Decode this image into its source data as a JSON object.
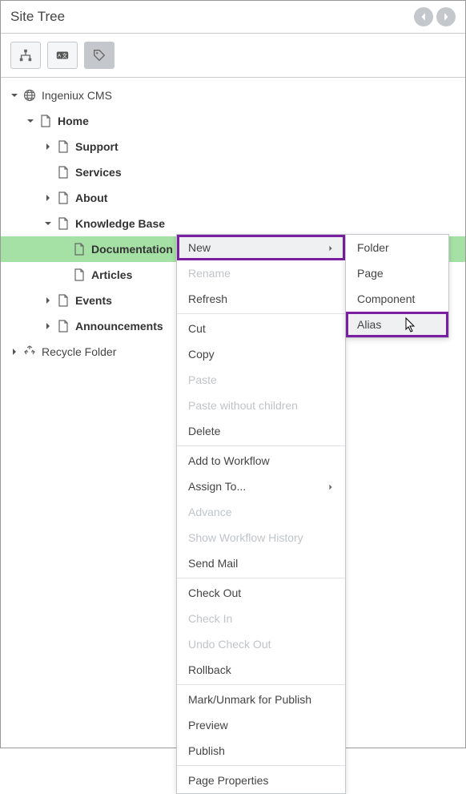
{
  "header": {
    "title": "Site Tree"
  },
  "tree": {
    "root": {
      "label": "Ingeniux CMS"
    },
    "home": {
      "label": "Home"
    },
    "support": {
      "label": "Support"
    },
    "services": {
      "label": "Services"
    },
    "about": {
      "label": "About"
    },
    "kb": {
      "label": "Knowledge Base"
    },
    "doc": {
      "label": "Documentation"
    },
    "articles": {
      "label": "Articles"
    },
    "events": {
      "label": "Events"
    },
    "announcements": {
      "label": "Announcements"
    },
    "recycle": {
      "label": "Recycle Folder"
    }
  },
  "ctx": {
    "new": "New",
    "rename": "Rename",
    "refresh": "Refresh",
    "cut": "Cut",
    "copy": "Copy",
    "paste": "Paste",
    "paste_wc": "Paste without children",
    "delete": "Delete",
    "add_wf": "Add to Workflow",
    "assign": "Assign To...",
    "advance": "Advance",
    "show_wf": "Show Workflow History",
    "send_mail": "Send Mail",
    "check_out": "Check Out",
    "check_in": "Check In",
    "undo_co": "Undo Check Out",
    "rollback": "Rollback",
    "mark": "Mark/Unmark for Publish",
    "preview": "Preview",
    "publish": "Publish",
    "page_props": "Page Properties"
  },
  "sub": {
    "folder": "Folder",
    "page": "Page",
    "component": "Component",
    "alias": "Alias"
  }
}
